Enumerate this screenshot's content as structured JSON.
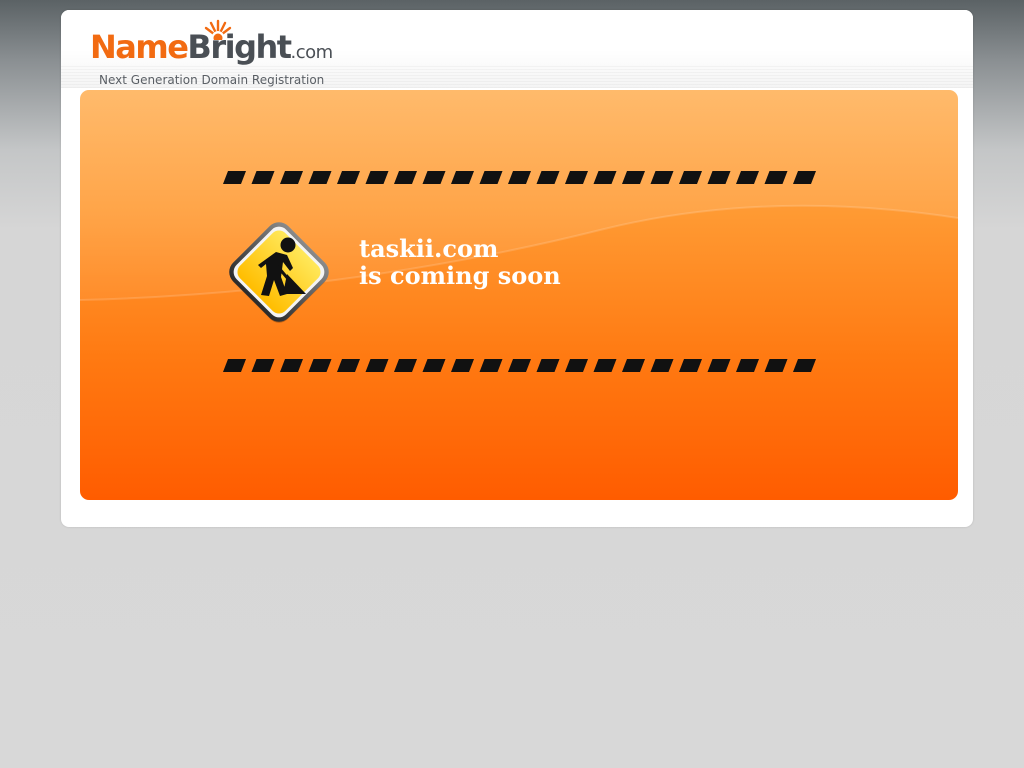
{
  "logo": {
    "name_part": "Name",
    "bright_part": "Bright",
    "tld_part": ".com",
    "tagline": "Next Generation Domain Registration",
    "icon": "sun-rays-icon",
    "colors": {
      "orange": "#f26b12",
      "gray": "#4a4f55"
    }
  },
  "panel": {
    "domain": "taskii.com",
    "status_line": "is coming soon",
    "sign_icon": "construction-worker-icon",
    "stripe": "hazard-stripe",
    "colors": {
      "panel_top": "#ffab4b",
      "panel_bottom": "#ff5c00",
      "sign_yellow": "#ffd21a"
    }
  }
}
